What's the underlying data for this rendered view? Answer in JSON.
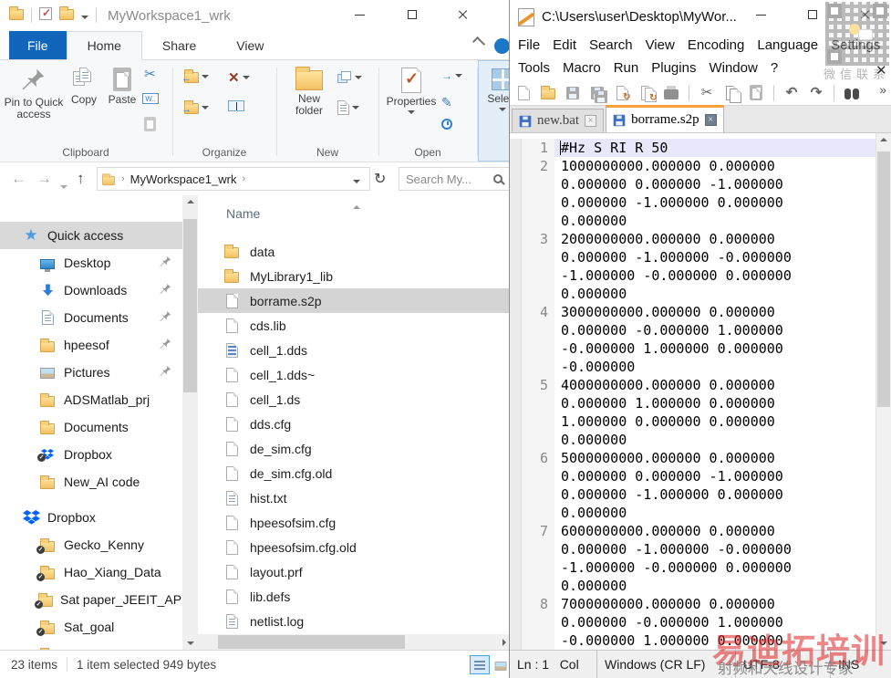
{
  "colors": {
    "accent_blue": "#1166bb",
    "tab_orange": "#f9a03c",
    "current_line": "#e8e8fd",
    "selection_gray": "#d4d4d4",
    "watermark_red": "#de2424"
  },
  "explorer": {
    "title": "MyWorkspace1_wrk",
    "ribbon_tabs": [
      {
        "label": "File",
        "style": "file"
      },
      {
        "label": "Home",
        "active": true
      },
      {
        "label": "Share"
      },
      {
        "label": "View"
      }
    ],
    "ribbon": {
      "pin": "Pin to Quick access",
      "copy": "Copy",
      "paste": "Paste",
      "new_folder": "New folder",
      "properties": "Properties",
      "select": "Select",
      "groups": {
        "clipboard": "Clipboard",
        "organize": "Organize",
        "new": "New",
        "open": "Open"
      }
    },
    "address": {
      "path": "MyWorkspace1_wrk",
      "search_placeholder": "Search My..."
    },
    "sidebar": {
      "items": [
        {
          "label": "Quick access",
          "icon": "star",
          "level": 0,
          "selected": true
        },
        {
          "label": "Desktop",
          "icon": "desktop",
          "level": 1,
          "pinned": true
        },
        {
          "label": "Downloads",
          "icon": "download",
          "level": 1,
          "pinned": true
        },
        {
          "label": "Documents",
          "icon": "document",
          "level": 1,
          "pinned": true
        },
        {
          "label": "hpeesof",
          "icon": "folder",
          "level": 1,
          "pinned": true
        },
        {
          "label": "Pictures",
          "icon": "picture",
          "level": 1,
          "pinned": true
        },
        {
          "label": "ADSMatlab_prj",
          "icon": "folder",
          "level": 1
        },
        {
          "label": "Documents",
          "icon": "folder",
          "level": 1
        },
        {
          "label": "Dropbox",
          "icon": "dropbox-sync",
          "level": 1
        },
        {
          "label": "New_AI code",
          "icon": "folder",
          "level": 1
        },
        {
          "label": "Dropbox",
          "icon": "dropbox",
          "level": 0,
          "section": true
        },
        {
          "label": "Gecko_Kenny",
          "icon": "folder-sync",
          "level": 1
        },
        {
          "label": "Hao_Xiang_Data",
          "icon": "folder-sync",
          "level": 1
        },
        {
          "label": "Sat paper_JEEIT_APM",
          "icon": "folder-sync",
          "level": 1
        },
        {
          "label": "Sat_goal",
          "icon": "folder-sync",
          "level": 1
        },
        {
          "label": "Sat",
          "icon": "folder",
          "level": 1,
          "partial": true
        }
      ]
    },
    "filelist": {
      "column": "Name",
      "items": [
        {
          "name": "data",
          "icon": "folder"
        },
        {
          "name": "MyLibrary1_lib",
          "icon": "folder"
        },
        {
          "name": "borrame.s2p",
          "icon": "file",
          "selected": true
        },
        {
          "name": "cds.lib",
          "icon": "file"
        },
        {
          "name": "cell_1.dds",
          "icon": "dds"
        },
        {
          "name": "cell_1.dds~",
          "icon": "file"
        },
        {
          "name": "cell_1.ds",
          "icon": "file"
        },
        {
          "name": "dds.cfg",
          "icon": "file"
        },
        {
          "name": "de_sim.cfg",
          "icon": "file"
        },
        {
          "name": "de_sim.cfg.old",
          "icon": "file"
        },
        {
          "name": "hist.txt",
          "icon": "text"
        },
        {
          "name": "hpeesofsim.cfg",
          "icon": "file"
        },
        {
          "name": "hpeesofsim.cfg.old",
          "icon": "file"
        },
        {
          "name": "layout.prf",
          "icon": "file"
        },
        {
          "name": "lib.defs",
          "icon": "file"
        },
        {
          "name": "netlist.log",
          "icon": "text"
        }
      ]
    },
    "statusbar": {
      "items_count": "23 items",
      "selection": "1 item selected 949 bytes"
    }
  },
  "notepad": {
    "title": "C:\\Users\\user\\Desktop\\MyWor...",
    "menus": {
      "row1": [
        "File",
        "Edit",
        "Search",
        "View",
        "Encoding",
        "Language",
        "Settings"
      ],
      "row2": [
        "Tools",
        "Macro",
        "Run",
        "Plugins",
        "Window",
        "?"
      ]
    },
    "toolbar": [
      "new",
      "open",
      "save",
      "saveall",
      "close",
      "closeall",
      "print",
      "|",
      "cut",
      "copy",
      "paste",
      "|",
      "undo",
      "redo",
      "|",
      "find"
    ],
    "tabs": [
      {
        "label": "new.bat",
        "active": false
      },
      {
        "label": "borrame.s2p",
        "active": true
      }
    ],
    "editor": {
      "lines": [
        {
          "num": "1",
          "highlight": true,
          "rows": [
            "#Hz S RI R 50"
          ]
        },
        {
          "num": "2",
          "rows": [
            "1000000000.000000 0.000000",
            "0.000000 0.000000 -1.000000",
            "0.000000 -1.000000 0.000000",
            "0.000000"
          ]
        },
        {
          "num": "3",
          "rows": [
            "2000000000.000000 0.000000",
            "0.000000 -1.000000 -0.000000",
            "-1.000000 -0.000000 0.000000",
            "0.000000"
          ]
        },
        {
          "num": "4",
          "rows": [
            "3000000000.000000 0.000000",
            "0.000000 -0.000000 1.000000",
            "-0.000000 1.000000 0.000000",
            "-0.000000"
          ]
        },
        {
          "num": "5",
          "rows": [
            "4000000000.000000 0.000000",
            "0.000000 1.000000 0.000000",
            "1.000000 0.000000 0.000000",
            "0.000000"
          ]
        },
        {
          "num": "6",
          "rows": [
            "5000000000.000000 0.000000",
            "0.000000 0.000000 -1.000000",
            "0.000000 -1.000000 0.000000",
            "0.000000"
          ]
        },
        {
          "num": "7",
          "rows": [
            "6000000000.000000 0.000000",
            "0.000000 -1.000000 -0.000000",
            "-1.000000 -0.000000 0.000000",
            "0.000000"
          ]
        },
        {
          "num": "8",
          "rows": [
            "7000000000.000000 0.000000",
            "0.000000 -0.000000 1.000000",
            "-0.000000 1.000000 0.000000"
          ]
        }
      ]
    },
    "statusbar": {
      "position": "Ln : 1   Col",
      "eol": "Windows (CR LF)",
      "encoding": "UTF-8",
      "mode": "INS"
    }
  },
  "watermark": {
    "qr_caption": "微信联系",
    "brand": "易迪拓培训",
    "slogan": "射频和天线设计专家"
  }
}
